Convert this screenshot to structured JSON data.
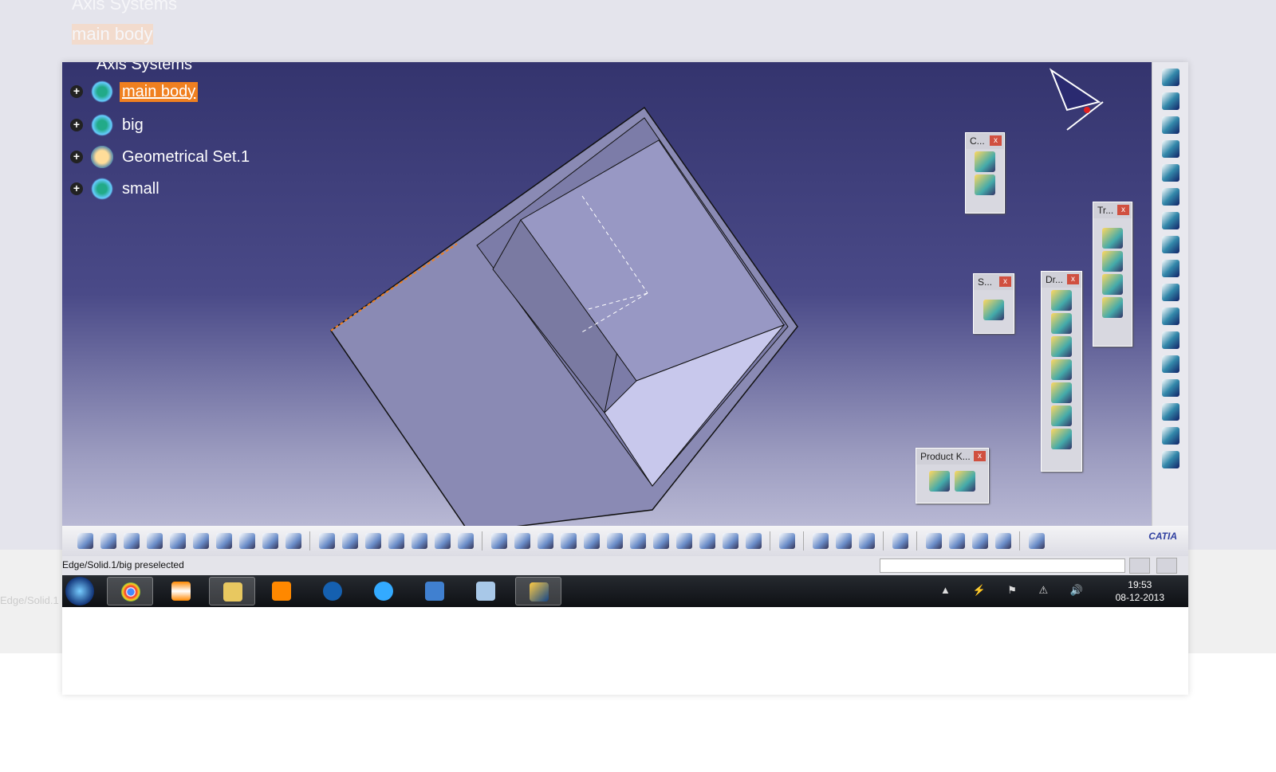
{
  "background": {
    "ghost_tree": [
      "Axis Systems",
      "main body"
    ],
    "ghost_status": "Edge/Solid.1"
  },
  "tree": {
    "items": [
      {
        "label": "Axis Systems",
        "icon": "axis-system-icon"
      },
      {
        "label": "main body",
        "icon": "body-gear-icon",
        "selected": true
      },
      {
        "label": "big",
        "icon": "body-gear-plus-icon"
      },
      {
        "label": "Geometrical Set.1",
        "icon": "geometrical-set-icon"
      },
      {
        "label": "small",
        "icon": "body-gear-plus-icon"
      }
    ]
  },
  "floating_toolbars": [
    {
      "title": "C...",
      "buttons": 2
    },
    {
      "title": "S...",
      "buttons": 1
    },
    {
      "title": "Dr...",
      "buttons": 7
    },
    {
      "title": "Tr...",
      "buttons": 4
    },
    {
      "title": "Product K...",
      "buttons": 2
    }
  ],
  "close_glyph": "x",
  "brand": "CATIA",
  "status": {
    "message": "Edge/Solid.1/big preselected",
    "command_input": ""
  },
  "taskbar": {
    "apps": [
      "Start",
      "Chrome",
      "VLC",
      "Windows Explorer",
      "Media Player",
      "HP",
      "Internet Explorer",
      "App",
      "Calculator",
      "CATIA"
    ],
    "time": "19:53",
    "date": "08-12-2013",
    "tray": "▲ ⚡ ⚑ ⚠ 🔊"
  },
  "colors": {
    "selection": "#f08020",
    "viewport_top": "#34346e",
    "viewport_bottom": "#b8b8d4",
    "part_face": "#8a8ab4"
  }
}
